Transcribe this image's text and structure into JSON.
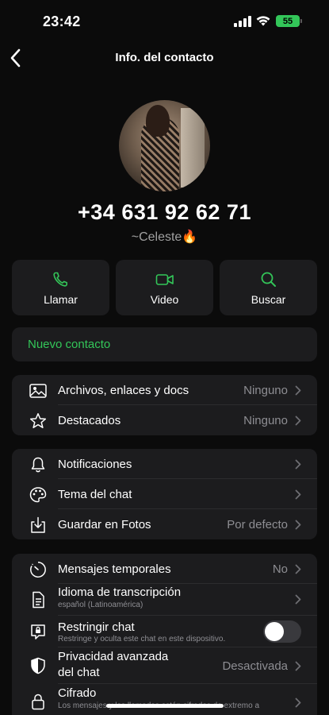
{
  "status_bar": {
    "time": "23:42",
    "battery": "55"
  },
  "nav": {
    "title": "Info. del contacto"
  },
  "contact": {
    "phone": "+34 631 92 62 71",
    "nickname": "~Celeste🔥"
  },
  "actions": [
    {
      "label": "Llamar",
      "icon": "phone-icon"
    },
    {
      "label": "Video",
      "icon": "video-icon"
    },
    {
      "label": "Buscar",
      "icon": "search-icon"
    }
  ],
  "new_contact": "Nuevo contacto",
  "media_group": [
    {
      "label": "Archivos, enlaces y docs",
      "value": "Ninguno",
      "icon": "photo-icon"
    },
    {
      "label": "Destacados",
      "value": "Ninguno",
      "icon": "star-icon"
    }
  ],
  "chat_group": [
    {
      "label": "Notificaciones",
      "value": "",
      "icon": "bell-icon"
    },
    {
      "label": "Tema del chat",
      "value": "",
      "icon": "palette-icon"
    },
    {
      "label": "Guardar en Fotos",
      "value": "Por defecto",
      "icon": "download-icon"
    }
  ],
  "privacy_group": [
    {
      "label": "Mensajes temporales",
      "value": "No",
      "icon": "timer-icon"
    },
    {
      "label": "Idioma de transcripción",
      "sub": "español (Latinoamérica)",
      "icon": "document-icon"
    },
    {
      "label": "Restringir chat",
      "sub": "Restringe y oculta este chat en este dispositivo.",
      "toggle": false,
      "icon": "chat-lock-icon"
    },
    {
      "label": "Privacidad avanzada del chat",
      "label_line1": "Privacidad avanzada",
      "label_line2": "del chat",
      "value": "Desactivada",
      "icon": "shield-icon"
    },
    {
      "label": "Cifrado",
      "sub": "Los mensajes y las llamadas están cifrados de extremo a",
      "icon": "lock-icon"
    }
  ],
  "colors": {
    "accent": "#33c659",
    "background": "#0b0b0b",
    "card": "#1c1c1e",
    "secondary_text": "#8e8e93"
  }
}
